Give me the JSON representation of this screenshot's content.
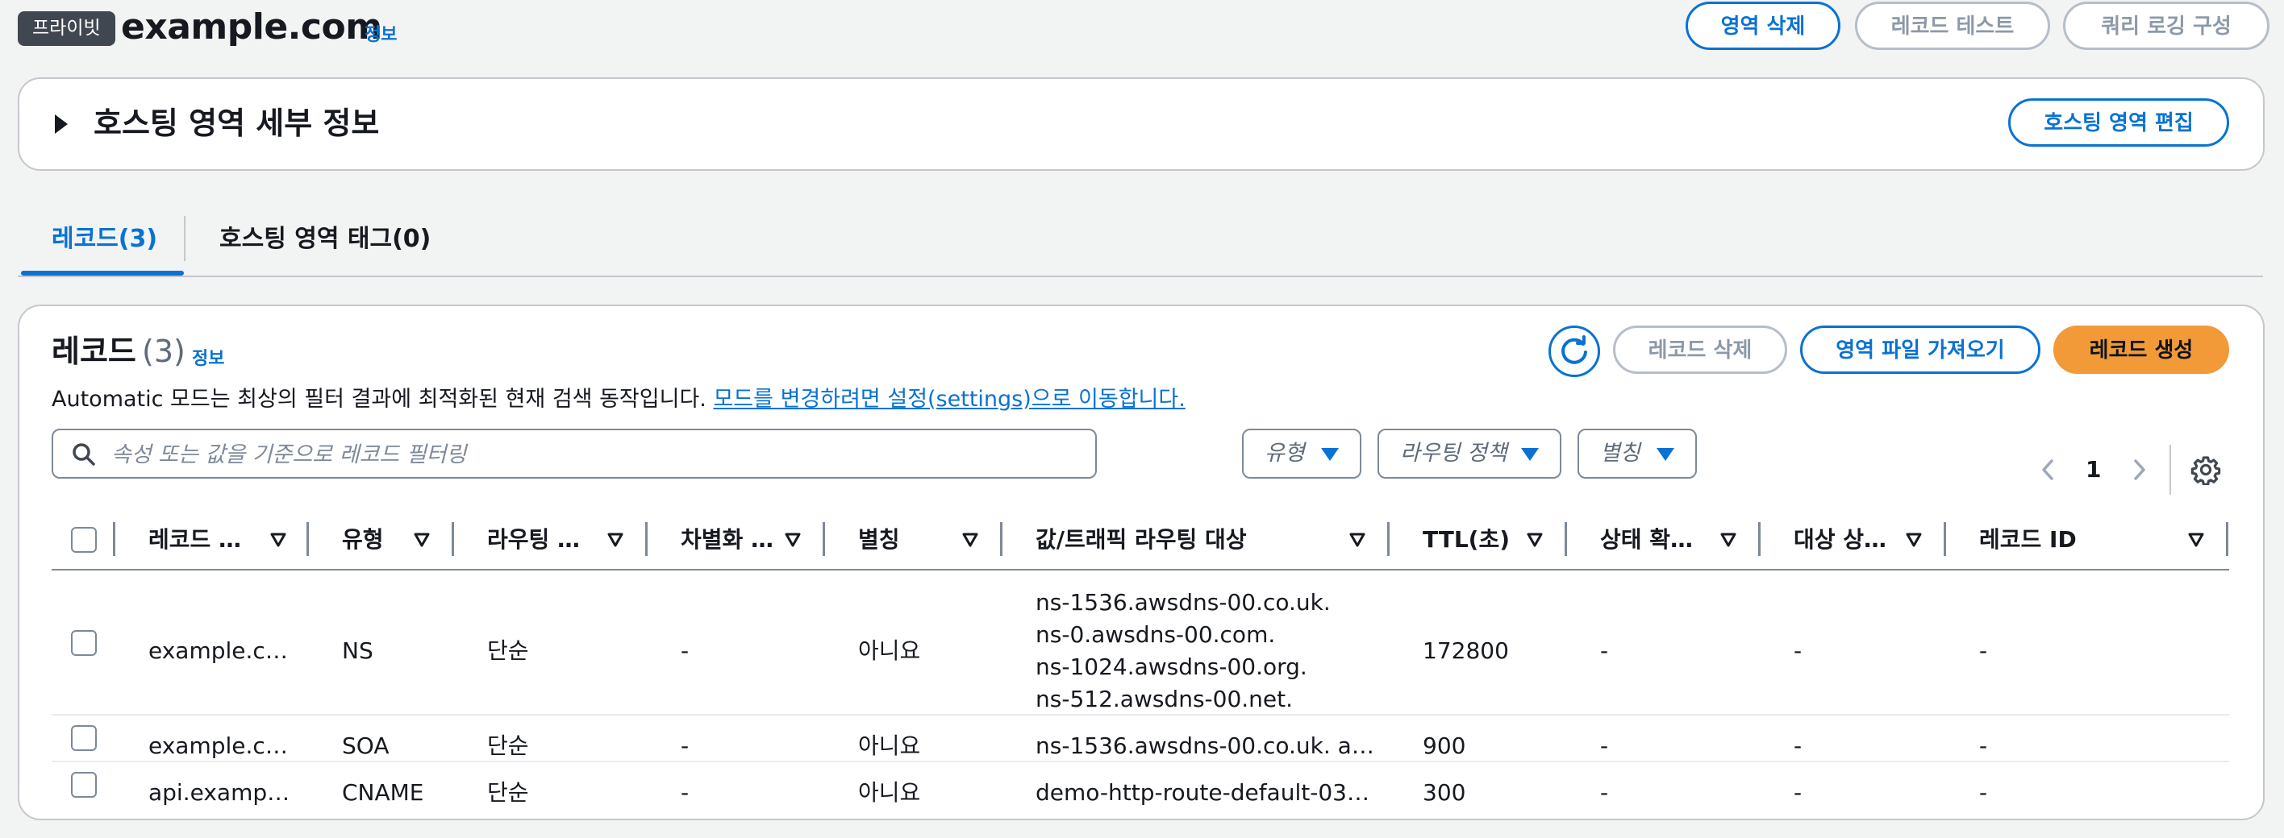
{
  "header": {
    "badge": "프라이빗",
    "zone_name": "example.com",
    "info": "정보",
    "delete_zone": "영역 삭제",
    "test_record": "레코드 테스트",
    "query_logging": "쿼리 로깅 구성"
  },
  "details": {
    "title": "호스팅 영역 세부 정보",
    "edit_button": "호스팅 영역 편집"
  },
  "tabs": [
    {
      "label": "레코드(3)",
      "active": true
    },
    {
      "label": "호스팅 영역 태그(0)",
      "active": false
    }
  ],
  "records": {
    "title": "레코드",
    "count": "(3)",
    "info": "정보",
    "delete_button": "레코드 삭제",
    "import_button": "영역 파일 가져오기",
    "create_button": "레코드 생성",
    "description": "Automatic 모드는 최상의 필터 결과에 최적화된 현재 검색 동작입니다.",
    "settings_link": "모드를 변경하려면 설정(settings)으로 이동합니다.",
    "search_placeholder": "속성 또는 값을 기준으로 레코드 필터링",
    "filters": {
      "type": "유형",
      "routing": "라우팅 정책",
      "alias": "별칭"
    },
    "page": "1",
    "columns": [
      "레코드 …",
      "유형",
      "라우팅 …",
      "차별화 …",
      "별칭",
      "값/트래픽 라우팅 대상",
      "TTL(초)",
      "상태 확…",
      "대상 상…",
      "레코드 ID"
    ],
    "rows": [
      {
        "name": "example.c…",
        "type": "NS",
        "routing": "단순",
        "diff": "-",
        "alias": "아니요",
        "value": [
          "ns-1536.awsdns-00.co.uk.",
          "ns-0.awsdns-00.com.",
          "ns-1024.awsdns-00.org.",
          "ns-512.awsdns-00.net."
        ],
        "ttl": "172800",
        "health": "-",
        "target": "-",
        "id": "-"
      },
      {
        "name": "example.c…",
        "type": "SOA",
        "routing": "단순",
        "diff": "-",
        "alias": "아니요",
        "value": [
          "ns-1536.awsdns-00.co.uk. a…"
        ],
        "ttl": "900",
        "health": "-",
        "target": "-",
        "id": "-"
      },
      {
        "name": "api.examp…",
        "type": "CNAME",
        "routing": "단순",
        "diff": "-",
        "alias": "아니요",
        "value": [
          "demo-http-route-default-03…"
        ],
        "ttl": "300",
        "health": "-",
        "target": "-",
        "id": "-"
      }
    ]
  },
  "colors": {
    "link": "#0972d3",
    "primary": "#f29a38",
    "badge": "#414750"
  }
}
